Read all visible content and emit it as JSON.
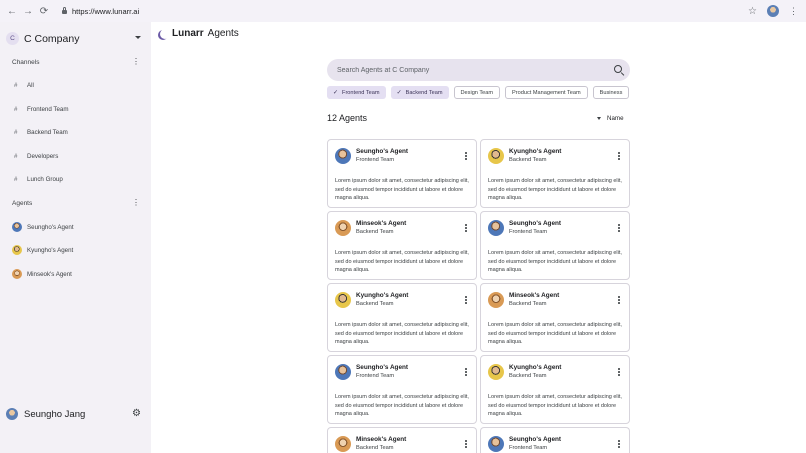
{
  "browser": {
    "url": "https://www.lunarr.ai"
  },
  "sidebar": {
    "workspace": {
      "initial": "C",
      "name": "C Company"
    },
    "channels_heading": "Channels",
    "channels": [
      "All",
      "Frontend Team",
      "Backend Team",
      "Developers",
      "Lunch Group"
    ],
    "agents_heading": "Agents",
    "agents": [
      {
        "name": "Seungho's Agent",
        "avatar": "blue"
      },
      {
        "name": "Kyungho's Agent",
        "avatar": "yellow"
      },
      {
        "name": "Minseok's Agent",
        "avatar": "orange"
      }
    ],
    "user": {
      "name": "Seungho Jang"
    }
  },
  "brand": {
    "name": "Lunarr",
    "section": "Agents"
  },
  "search": {
    "placeholder": "Search Agents at C Company"
  },
  "filters": [
    {
      "label": "Frontend Team",
      "selected": true
    },
    {
      "label": "Backend Team",
      "selected": true
    },
    {
      "label": "Design Team",
      "selected": false
    },
    {
      "label": "Product Management Team",
      "selected": false
    },
    {
      "label": "Business",
      "selected": false
    }
  ],
  "results": {
    "count_label": "12 Agents",
    "sort_label": "Name"
  },
  "agents": [
    {
      "name": "Seungho's Agent",
      "team": "Frontend Team",
      "avatar": "blue",
      "description": "Lorem ipsum dolor sit amet, consectetur adipiscing elit, sed do eiusmod tempor incididunt ut labore et dolore magna aliqua."
    },
    {
      "name": "Kyungho's Agent",
      "team": "Backend Team",
      "avatar": "yellow",
      "description": "Lorem ipsum dolor sit amet, consectetur adipiscing elit, sed do eiusmod tempor incididunt ut labore et dolore magna aliqua."
    },
    {
      "name": "Minseok's Agent",
      "team": "Backend Team",
      "avatar": "orange",
      "description": "Lorem ipsum dolor sit amet, consectetur adipiscing elit, sed do eiusmod tempor incididunt ut labore et dolore magna aliqua."
    },
    {
      "name": "Seungho's Agent",
      "team": "Frontend Team",
      "avatar": "blue",
      "description": "Lorem ipsum dolor sit amet, consectetur adipiscing elit, sed do eiusmod tempor incididunt ut labore et dolore magna aliqua."
    },
    {
      "name": "Kyungho's Agent",
      "team": "Backend Team",
      "avatar": "yellow",
      "description": "Lorem ipsum dolor sit amet, consectetur adipiscing elit, sed do eiusmod tempor incididunt ut labore et dolore magna aliqua."
    },
    {
      "name": "Minseok's Agent",
      "team": "Backend Team",
      "avatar": "orange",
      "description": "Lorem ipsum dolor sit amet, consectetur adipiscing elit, sed do eiusmod tempor incididunt ut labore et dolore magna aliqua."
    },
    {
      "name": "Seungho's Agent",
      "team": "Frontend Team",
      "avatar": "blue",
      "description": "Lorem ipsum dolor sit amet, consectetur adipiscing elit, sed do eiusmod tempor incididunt ut labore et dolore magna aliqua."
    },
    {
      "name": "Kyungho's Agent",
      "team": "Backend Team",
      "avatar": "yellow",
      "description": "Lorem ipsum dolor sit amet, consectetur adipiscing elit, sed do eiusmod tempor incididunt ut labore et dolore magna aliqua."
    },
    {
      "name": "Minseok's Agent",
      "team": "Backend Team",
      "avatar": "orange",
      "description": ""
    },
    {
      "name": "Seungho's Agent",
      "team": "Frontend Team",
      "avatar": "blue",
      "description": ""
    }
  ],
  "colors": {
    "sidebar_bg": "#f3f1f6",
    "chip_selected_bg": "#e4dff2",
    "search_bg": "#e7e3ee",
    "brand_moon": "#6b5aa6"
  },
  "icons": [
    "back-arrow-icon",
    "forward-arrow-icon",
    "reload-icon",
    "lock-icon",
    "star-icon",
    "kebab-icon",
    "chevron-down-icon",
    "hash-icon",
    "search-icon",
    "check-icon",
    "sort-caret-icon",
    "gear-icon",
    "moon-logo-icon"
  ]
}
